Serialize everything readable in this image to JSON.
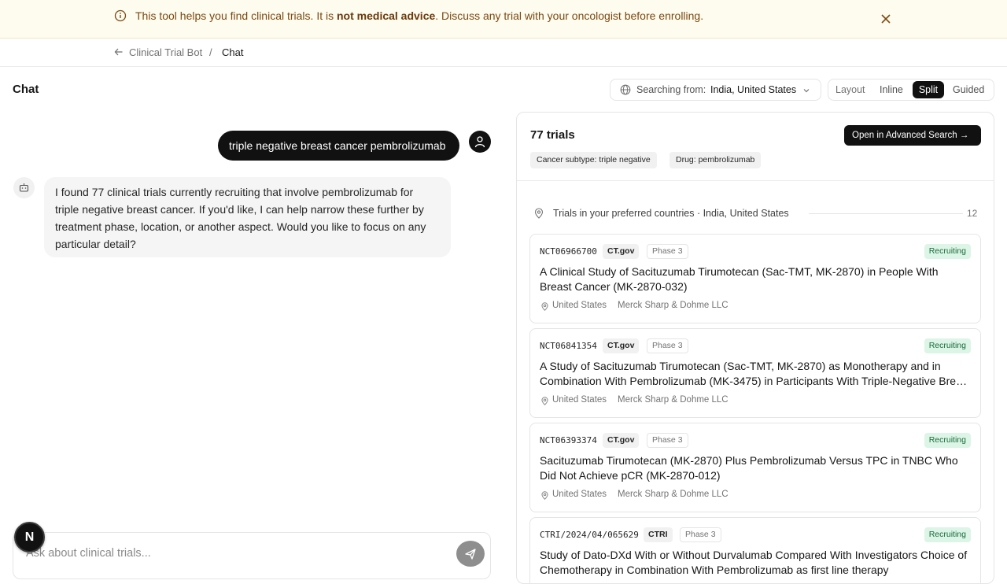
{
  "banner": {
    "text_before": "This tool helps you find clinical trials. It is ",
    "text_bold": "not medical advice",
    "text_after": ". Discuss any trial with your oncologist before enrolling."
  },
  "breadcrumb": {
    "parent": "Clinical Trial Bot",
    "separator": "/",
    "current": "Chat"
  },
  "header": {
    "title": "Chat",
    "searching_label": "Searching from:",
    "searching_value": "India, United States",
    "layout": {
      "label": "Layout",
      "options": [
        "Inline",
        "Split",
        "Guided"
      ],
      "selected": "Split"
    }
  },
  "chat": {
    "user_message": "triple negative breast cancer pembrolizumab",
    "bot_message": "I found 77 clinical trials currently recruiting that involve pembrolizumab for triple negative breast cancer. If you'd like, I can help narrow these further by treatment phase, location, or another aspect. Would you like to focus on any particular detail?",
    "composer_placeholder": "Ask about clinical trials...",
    "fab_label": "N"
  },
  "results": {
    "count": "77 trials",
    "advanced_button": "Open in Advanced Search →",
    "filters": [
      "Cancer subtype: triple negative",
      "Drug: pembrolizumab"
    ],
    "preferred": {
      "label": "Trials in your preferred countries · India, United States",
      "count": "12"
    },
    "trials": [
      {
        "id": "NCT06966700",
        "source": "CT.gov",
        "phase": "Phase 3",
        "status": "Recruiting",
        "title": "A Clinical Study of Sacituzumab Tirumotecan (Sac-TMT, MK-2870) in People With Breast Cancer (MK-2870-032)",
        "location": "United States",
        "sponsor": "Merck Sharp & Dohme LLC"
      },
      {
        "id": "NCT06841354",
        "source": "CT.gov",
        "phase": "Phase 3",
        "status": "Recruiting",
        "title": "A Study of Sacituzumab Tirumotecan (Sac-TMT, MK-2870) as Monotherapy and in Combination With Pembrolizumab (MK-3475) in Participants With Triple-Negative Breast Cancer",
        "location": "United States",
        "sponsor": "Merck Sharp & Dohme LLC"
      },
      {
        "id": "NCT06393374",
        "source": "CT.gov",
        "phase": "Phase 3",
        "status": "Recruiting",
        "title": "Sacituzumab Tirumotecan (MK-2870) Plus Pembrolizumab Versus TPC in TNBC Who Did Not Achieve pCR (MK-2870-012)",
        "location": "United States",
        "sponsor": "Merck Sharp & Dohme LLC"
      },
      {
        "id": "CTRI/2024/04/065629",
        "source": "CTRI",
        "phase": "Phase 3",
        "status": "Recruiting",
        "title": "Study of Dato-DXd With or Without Durvalumab Compared With Investigators Choice of Chemotherapy in Combination With Pembrolizumab as first line therapy",
        "location": "",
        "sponsor": ""
      }
    ]
  },
  "colors": {
    "banner_bg": "#fefbef",
    "banner_text": "#7a4a12",
    "status_bg": "#dcf5e6",
    "status_text": "#1a6b3b",
    "primary": "#111111"
  }
}
